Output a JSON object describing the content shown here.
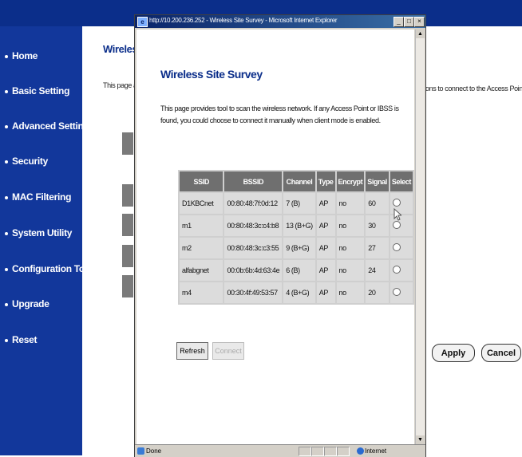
{
  "background": {
    "nav": [
      "Home",
      "Basic Setting",
      "Advanced Setting",
      "Security",
      "MAC Filtering",
      "System Utility",
      "Configuration Tool",
      "Upgrade",
      "Reset"
    ],
    "heading": "Wireless",
    "text_left": "This page al",
    "text_right": "ons to connect to the Access Point.",
    "apply_label": "Apply",
    "cancel_label": "Cancel"
  },
  "popup": {
    "window_title": "http://10.200.236.252 - Wireless Site Survey - Microsoft Internet Explorer",
    "title": "Wireless Site Survey",
    "description": "This page provides tool to scan the wireless network. If any Access Point or IBSS is found, you could choose to connect it manually when client mode is enabled.",
    "columns": [
      "SSID",
      "BSSID",
      "Channel",
      "Type",
      "Encrypt",
      "Signal",
      "Select"
    ],
    "rows": [
      [
        "D1KBCnet",
        "00:80:48:7f:0d:12",
        "7 (B)",
        "AP",
        "no",
        "60"
      ],
      [
        "m1",
        "00:80:48:3c:c4:b8",
        "13 (B+G)",
        "AP",
        "no",
        "30"
      ],
      [
        "m2",
        "00:80:48:3c:c3:55",
        "9 (B+G)",
        "AP",
        "no",
        "27"
      ],
      [
        "alfabgnet",
        "00:0b:6b:4d:63:4e",
        "6 (B)",
        "AP",
        "no",
        "24"
      ],
      [
        "m4",
        "00:30:4f:49:53:57",
        "4 (B+G)",
        "AP",
        "no",
        "20"
      ]
    ],
    "refresh_label": "Refresh",
    "connect_label": "Connect",
    "status_text": "Done",
    "zone_text": "Internet"
  },
  "colors": {
    "nav_bg": "#12379b",
    "title_blue": "#0b2e8a",
    "header_gray": "#6f6f6f"
  }
}
